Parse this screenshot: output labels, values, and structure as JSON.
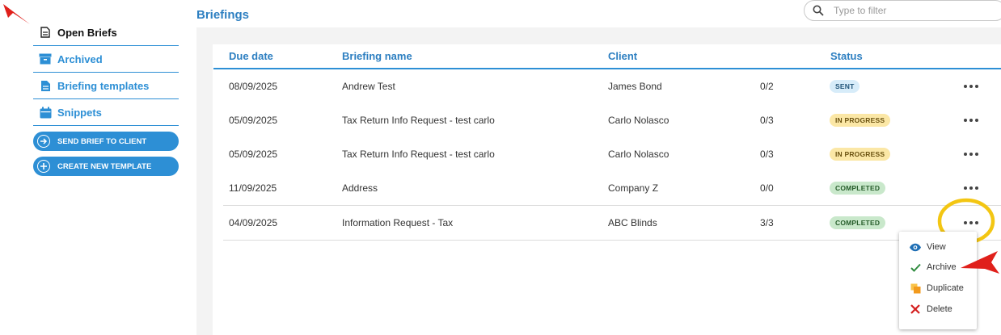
{
  "sidebar": {
    "items": [
      {
        "label": "Open Briefs"
      },
      {
        "label": "Archived"
      },
      {
        "label": "Briefing templates"
      },
      {
        "label": "Snippets"
      }
    ],
    "send_button": "SEND BRIEF TO CLIENT",
    "create_button": "CREATE NEW TEMPLATE"
  },
  "header": {
    "title": "Briefings",
    "search_placeholder": "Type to filter"
  },
  "table": {
    "columns": [
      "Due date",
      "Briefing name",
      "Client",
      "Status"
    ],
    "rows": [
      {
        "due": "08/09/2025",
        "name": "Andrew Test",
        "client": "James Bond",
        "progress": "0/2",
        "status": "SENT"
      },
      {
        "due": "05/09/2025",
        "name": "Tax Return Info Request - test carlo",
        "client": "Carlo Nolasco",
        "progress": "0/3",
        "status": "IN PROGRESS"
      },
      {
        "due": "05/09/2025",
        "name": "Tax Return Info Request - test carlo",
        "client": "Carlo Nolasco",
        "progress": "0/3",
        "status": "IN PROGRESS"
      },
      {
        "due": "11/09/2025",
        "name": "Address",
        "client": "Company Z",
        "progress": "0/0",
        "status": "COMPLETED"
      },
      {
        "due": "04/09/2025",
        "name": "Information Request - Tax",
        "client": "ABC Blinds",
        "progress": "3/3",
        "status": "COMPLETED"
      }
    ]
  },
  "menu": {
    "items": [
      {
        "label": "View",
        "icon": "eye-icon"
      },
      {
        "label": "Archive",
        "icon": "check-icon"
      },
      {
        "label": "Duplicate",
        "icon": "duplicate-icon"
      },
      {
        "label": "Delete",
        "icon": "x-icon"
      }
    ]
  },
  "colors": {
    "accent": "#2d8fd5",
    "annotation_red": "#e0201b",
    "annotation_yellow": "#f3c613",
    "sent_badge": "#d7ecf9",
    "progress_badge": "#fbe7a6",
    "completed_badge": "#c9e8cb"
  }
}
